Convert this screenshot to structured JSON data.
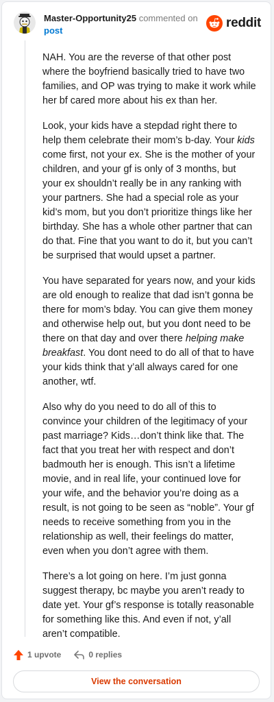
{
  "comment": {
    "username": "Master-Opportunity25",
    "meta_text": "commented on",
    "post_link": "post",
    "paragraphs": [
      [
        "NAH. You are the reverse of that other post where the boyfriend basically tried to have two families, and OP was trying to make it work while her bf cared more about his ex than her."
      ],
      [
        "Look, your kids have a stepdad right there to help them celebrate their mom’s b-day. Your ",
        "kids",
        " come first, not your ex. She is the mother of your children, and your gf is only of 3 months, but your ex shouldn’t really be in any ranking with your partners. She had a special role as your kid’s mom, but you don’t prioritize things like her birthday. She has a whole other partner that can do that. Fine that you want to do it, but you can’t be surprised that would upset a partner."
      ],
      [
        "You have separated for years now, and your kids are old enough to realize that dad isn’t gonna be there for mom’s bday. You can give them money and otherwise help out, but you dont need to be there on that day and over there ",
        "helping make breakfast",
        ". You dont need to do all of that to have your kids think that y’all always cared for one another, wtf."
      ],
      [
        "Also why do you need to do all of this to convince your children of the legitimacy of your past marriage? Kids…don’t think like that. The fact that you treat her with respect and don’t badmouth her is enough. This isn’t a lifetime movie, and in real life, your continued love for your wife, and the behavior you’re doing as a result, is not going to be seen as “noble”. Your gf needs to receive something from you in the relationship as well, their feelings do matter, even when you don’t agree with them."
      ],
      [
        "There’s a lot going on here. I’m just gonna suggest therapy, bc maybe you aren’t ready to date yet. Your gf’s response is totally reasonable for something like this. And even if not, y’all aren’t compatible."
      ]
    ]
  },
  "brand": {
    "name": "reddit",
    "icon": "reddit-logo-icon",
    "color": "#ff4500"
  },
  "actions": {
    "upvote_label": "1 upvote",
    "upvote_icon": "upvote-arrow-icon",
    "upvote_color": "#ff4500",
    "replies_label": "0 replies",
    "replies_icon": "reply-icon"
  },
  "view_button_label": "View the conversation",
  "accent_color": "#d93a00"
}
